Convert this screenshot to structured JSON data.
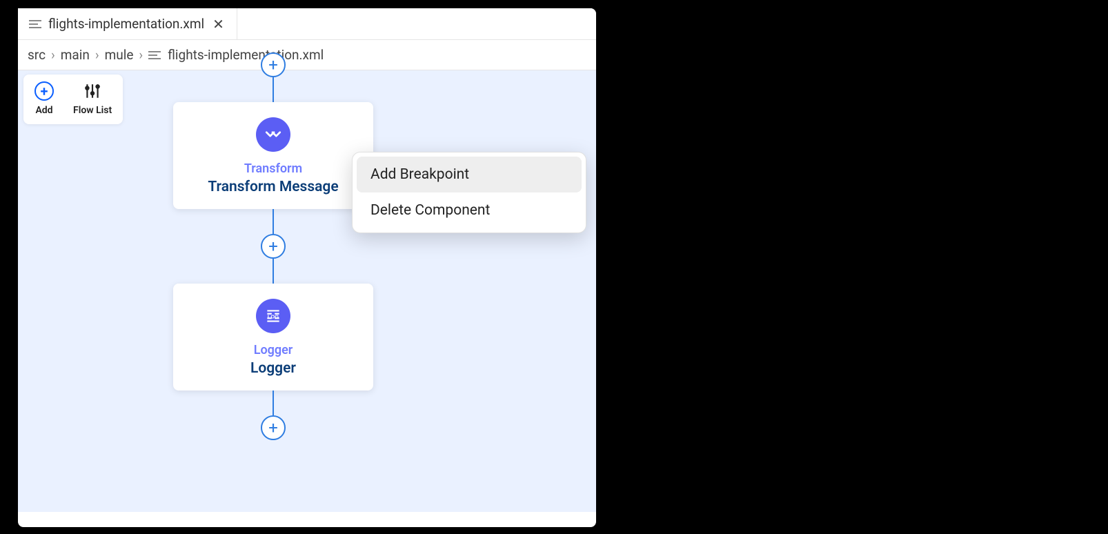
{
  "tab": {
    "filename": "flights-implementation.xml"
  },
  "breadcrumb": {
    "segments": [
      "src",
      "main",
      "mule",
      "flights-implementation.xml"
    ]
  },
  "toolbar": {
    "add_label": "Add",
    "flow_list_label": "Flow List"
  },
  "flow": {
    "nodes": [
      {
        "type": "Transform",
        "name": "Transform Message",
        "icon": "transform-icon"
      },
      {
        "type": "Logger",
        "name": "Logger",
        "icon": "log-icon"
      }
    ]
  },
  "context_menu": {
    "items": [
      {
        "label": "Add Breakpoint",
        "hover": true
      },
      {
        "label": "Delete Component",
        "hover": false
      }
    ]
  }
}
